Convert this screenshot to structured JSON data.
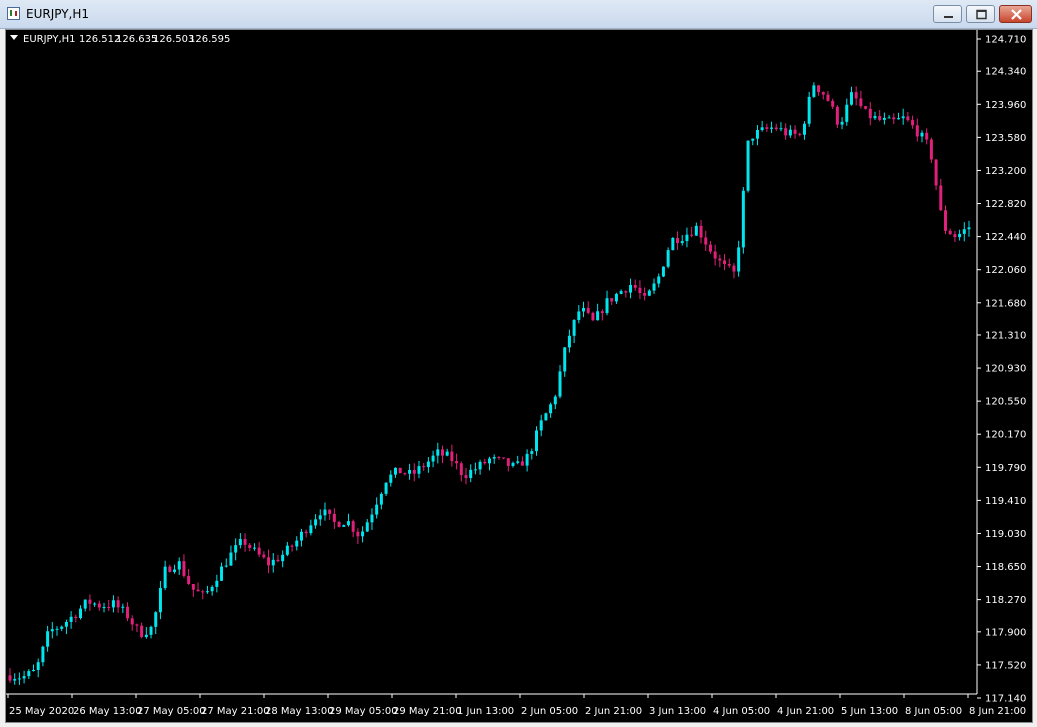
{
  "window": {
    "title": "EURJPY,H1",
    "minimize_icon": "minimize-icon",
    "maximize_icon": "maximize-icon",
    "close_icon": "close-icon"
  },
  "info_bar": {
    "symbol": "EURJPY,H1",
    "open": "126.512",
    "high": "126.635",
    "low": "126.503",
    "close": "126.595"
  },
  "colors": {
    "background": "#000000",
    "bull": "#00e5ee",
    "bear": "#e0207a",
    "text": "#ffffff"
  },
  "chart_data": {
    "type": "candlestick",
    "symbol": "EURJPY",
    "timeframe": "H1",
    "ylim": [
      117.14,
      124.71
    ],
    "y_ticks": [
      "124.710",
      "124.340",
      "123.960",
      "123.580",
      "123.200",
      "122.820",
      "122.440",
      "122.060",
      "121.680",
      "121.310",
      "120.930",
      "120.550",
      "120.170",
      "119.790",
      "119.410",
      "119.030",
      "118.650",
      "118.270",
      "117.900",
      "117.520",
      "117.140"
    ],
    "x_ticks": [
      "25 May 2020",
      "26 May 13:00",
      "27 May 05:00",
      "27 May 21:00",
      "28 May 13:00",
      "29 May 05:00",
      "29 May 21:00",
      "1 Jun 13:00",
      "2 Jun 05:00",
      "2 Jun 21:00",
      "3 Jun 13:00",
      "4 Jun 05:00",
      "4 Jun 21:00",
      "5 Jun 13:00",
      "8 Jun 05:00",
      "8 Jun 21:00"
    ],
    "close_path": [
      117.4,
      117.38,
      117.45,
      117.9,
      117.98,
      118.1,
      118.25,
      118.2,
      118.22,
      118.1,
      117.88,
      117.95,
      118.62,
      118.7,
      118.4,
      118.3,
      118.55,
      118.78,
      118.95,
      118.8,
      118.68,
      118.78,
      118.92,
      119.12,
      119.3,
      119.15,
      119.18,
      119.0,
      119.3,
      119.65,
      119.75,
      119.7,
      119.82,
      119.95,
      119.9,
      119.7,
      119.78,
      119.88,
      119.85,
      119.78,
      119.92,
      120.3,
      120.58,
      121.25,
      121.62,
      121.45,
      121.68,
      121.8,
      121.9,
      121.7,
      121.95,
      122.4,
      122.45,
      122.55,
      122.3,
      122.1,
      122.0,
      123.58,
      123.65,
      123.7,
      123.62,
      123.6,
      124.2,
      124.05,
      123.72,
      124.08,
      123.85,
      123.78,
      123.75,
      123.8,
      123.65,
      123.45,
      122.55,
      122.44,
      122.55
    ],
    "candle_count": 205
  }
}
